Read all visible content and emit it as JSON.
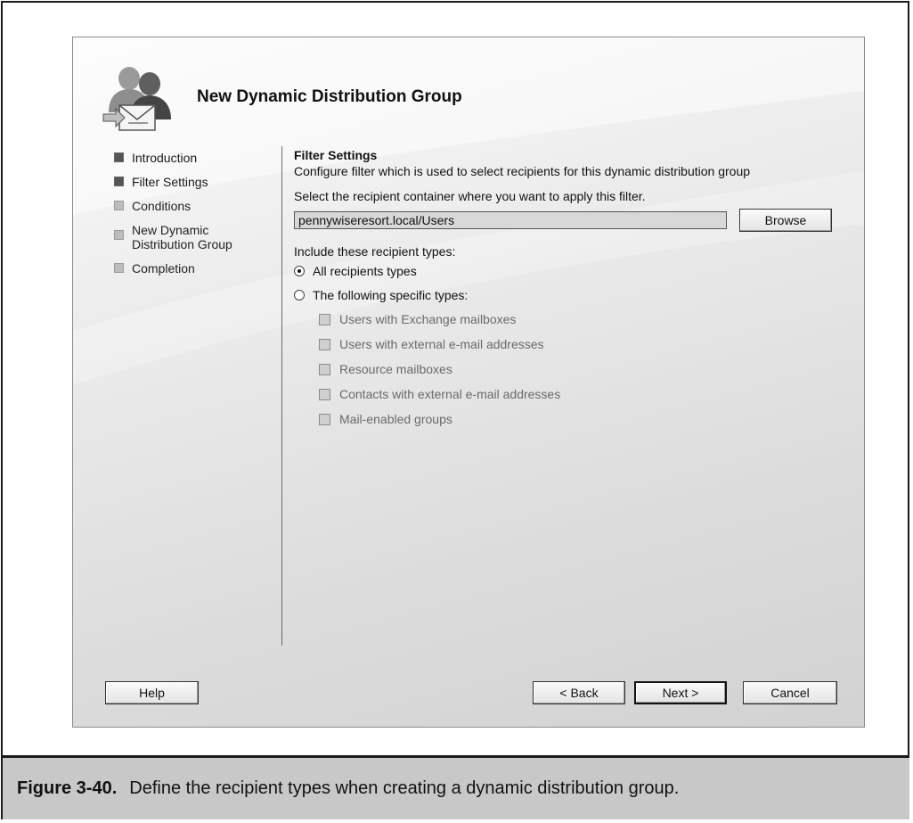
{
  "wizard": {
    "title": "New Dynamic Distribution Group"
  },
  "nav": {
    "items": [
      {
        "label": "Introduction",
        "state": "done"
      },
      {
        "label": "Filter Settings",
        "state": "current"
      },
      {
        "label": "Conditions",
        "state": "pending"
      },
      {
        "label": "New Dynamic Distribution Group",
        "state": "pending"
      },
      {
        "label": "Completion",
        "state": "pending"
      }
    ]
  },
  "content": {
    "section_title": "Filter Settings",
    "description": "Configure filter which is used to select recipients for this dynamic distribution group",
    "container_label": "Select the recipient container where you want to apply this filter.",
    "container_value": "pennywiseresort.local/Users",
    "browse_label": "Browse",
    "types_label": "Include these recipient types:",
    "radio_all": "All recipients types",
    "radio_specific": "The following specific types:",
    "selected_radio": "all",
    "checkboxes": [
      "Users with Exchange mailboxes",
      "Users with external e-mail addresses",
      "Resource mailboxes",
      "Contacts with external e-mail addresses",
      "Mail-enabled groups"
    ]
  },
  "buttons": {
    "help": "Help",
    "back": "< Back",
    "next": "Next >",
    "cancel": "Cancel"
  },
  "figure": {
    "number": "Figure 3-40.",
    "caption": "Define the recipient types when creating a dynamic distribution group."
  },
  "icons": {
    "header": "users-mail-icon"
  }
}
